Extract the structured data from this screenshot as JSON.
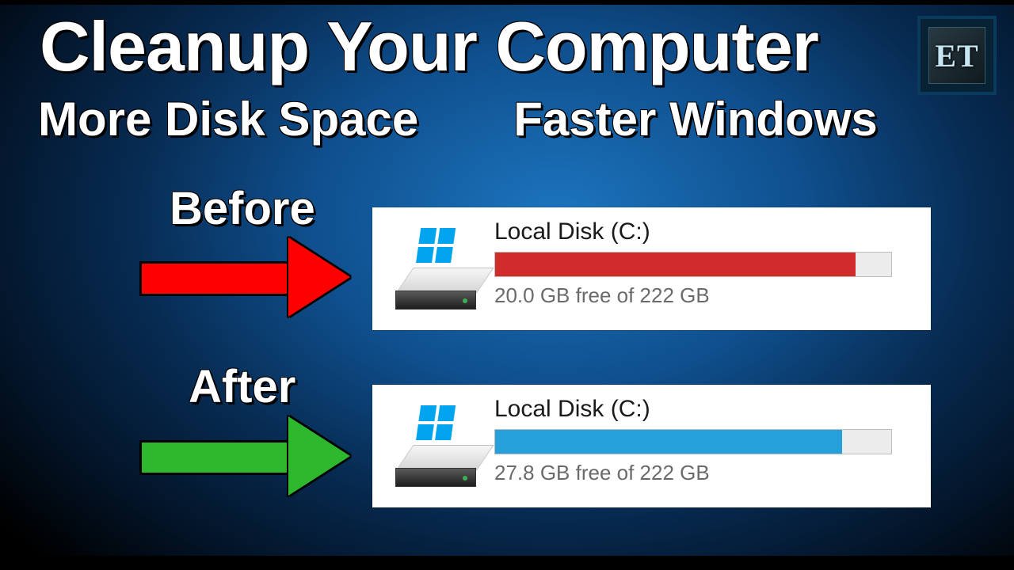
{
  "logo": {
    "text": "ET"
  },
  "heading": "Cleanup Your Computer",
  "subheading_left": "More Disk Space",
  "subheading_right": "Faster Windows",
  "labels": {
    "before": "Before",
    "after": "After"
  },
  "arrow_colors": {
    "before": "#ff0000",
    "after": "#2db82d"
  },
  "panels": {
    "before": {
      "title": "Local Disk (C:)",
      "free_text": "20.0 GB free of 222 GB",
      "fill_percent": 91,
      "fill_color": "#d12c2c"
    },
    "after": {
      "title": "Local Disk (C:)",
      "free_text": "27.8 GB free of 222 GB",
      "fill_percent": 87.5,
      "fill_color": "#26a0da"
    }
  }
}
